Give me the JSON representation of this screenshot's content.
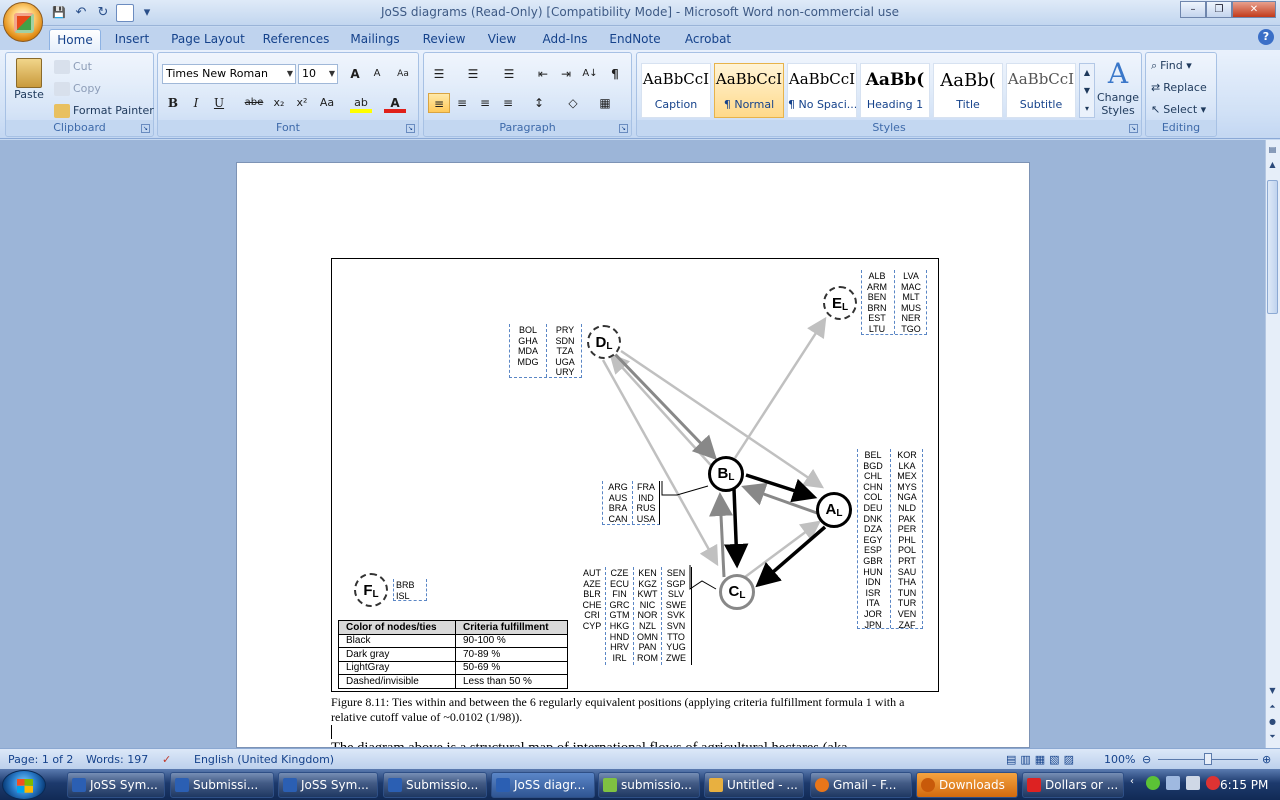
{
  "window": {
    "title": "JoSS diagrams (Read-Only) [Compatibility Mode] - Microsoft Word non-commercial use",
    "minimize": "–",
    "restore": "❐",
    "close": "✕"
  },
  "qat": {
    "save": "💾",
    "undo": "↶",
    "redo": "↻",
    "customize": "▾"
  },
  "tabs": [
    "Home",
    "Insert",
    "Page Layout",
    "References",
    "Mailings",
    "Review",
    "View",
    "Add-Ins",
    "EndNote",
    "Acrobat"
  ],
  "clipboard": {
    "group": "Clipboard",
    "paste": "Paste",
    "cut": "Cut",
    "copy": "Copy",
    "format_painter": "Format Painter"
  },
  "font": {
    "group": "Font",
    "name": "Times New Roman",
    "size": "10",
    "grow": "A",
    "shrink": "A",
    "clear": "Aa",
    "bold": "B",
    "italic": "I",
    "underline": "U",
    "strike": "abe",
    "subscript": "x₂",
    "superscript": "x²",
    "case": "Aa",
    "highlight": "ab",
    "color": "A"
  },
  "paragraph": {
    "group": "Paragraph",
    "bullets": "☰",
    "numbering": "☰",
    "multilevel": "☰",
    "dec_indent": "⇤",
    "inc_indent": "⇥",
    "sort": "A↓",
    "pilcrow": "¶",
    "align_left": "≡",
    "center": "≡",
    "align_right": "≡",
    "justify": "≡",
    "spacing": "↕",
    "shading": "◇",
    "borders": "▦"
  },
  "styles": {
    "group": "Styles",
    "preview": "AaBbCcI",
    "heading_preview": "AaBb(",
    "items": [
      "Caption",
      "¶ Normal",
      "¶ No Spaci...",
      "Heading 1",
      "Title",
      "Subtitle"
    ],
    "change_styles": "Change Styles"
  },
  "editing": {
    "group": "Editing",
    "find": "Find",
    "replace": "Replace",
    "select": "Select"
  },
  "figure": {
    "nodes": {
      "A": "A",
      "B": "B",
      "C": "C",
      "D": "D",
      "E": "E",
      "F": "F",
      "sub": "L"
    },
    "E_list": {
      "c1": [
        "ALB",
        "ARM",
        "BEN",
        "BRN",
        "EST",
        "LTU"
      ],
      "c2": [
        "LVA",
        "MAC",
        "MLT",
        "MUS",
        "NER",
        "TGO"
      ]
    },
    "D_list": {
      "c1": [
        "BOL",
        "GHA",
        "MDA",
        "MDG"
      ],
      "c2": [
        "PRY",
        "SDN",
        "TZA",
        "UGA",
        "URY"
      ]
    },
    "A_list": {
      "c1": [
        "BEL",
        "BGD",
        "CHL",
        "CHN",
        "COL",
        "DEU",
        "DNK",
        "DZA",
        "EGY",
        "ESP",
        "GBR",
        "HUN",
        "IDN",
        "ISR",
        "ITA",
        "JOR",
        "JPN"
      ],
      "c2": [
        "KOR",
        "LKA",
        "MEX",
        "MYS",
        "NGA",
        "NLD",
        "PAK",
        "PER",
        "PHL",
        "POL",
        "PRT",
        "SAU",
        "THA",
        "TUN",
        "TUR",
        "VEN",
        "ZAF"
      ]
    },
    "B_list": {
      "c1": [
        "ARG",
        "AUS",
        "BRA",
        "CAN"
      ],
      "c2": [
        "FRA",
        "IND",
        "RUS",
        "USA"
      ]
    },
    "C_list": {
      "c1": [
        "AUT",
        "AZE",
        "BLR",
        "CHE",
        "CRI",
        "CYP"
      ],
      "c2": [
        "CZE",
        "ECU",
        "FIN",
        "GRC",
        "GTM",
        "HKG",
        "HND",
        "HRV",
        "IRL"
      ],
      "c3": [
        "KEN",
        "KGZ",
        "KWT",
        "NIC",
        "NOR",
        "NZL",
        "OMN",
        "PAN",
        "ROM"
      ],
      "c4": [
        "SEN",
        "SGP",
        "SLV",
        "SWE",
        "SVK",
        "SVN",
        "TTO",
        "YUG",
        "ZWE"
      ]
    },
    "F_list": {
      "c1": [
        "BRB",
        "ISL"
      ]
    },
    "legend": {
      "headers": [
        "Color of nodes/ties",
        "Criteria fulfillment"
      ],
      "rows": [
        [
          "Black",
          "90-100 %"
        ],
        [
          "Dark gray",
          "70-89 %"
        ],
        [
          "LightGray",
          "50-69 %"
        ],
        [
          "Dashed/invisible",
          "Less than 50 %"
        ]
      ]
    },
    "caption": "Figure 8.11: Ties within and between the 6 regularly equivalent positions (applying criteria fulfillment formula 1 with a relative cutoff value of ~0.0102 (1/98)).",
    "body_text": "The diagram above is a structural map of international flows of agricultural hectares (aka",
    "colors": {
      "black": "#000000",
      "dark_gray": "#888888",
      "light_gray": "#c0c0c0"
    }
  },
  "status": {
    "page": "Page: 1 of 2",
    "words": "Words: 197",
    "language": "English (United Kingdom)",
    "zoom": "100%"
  },
  "taskbar": {
    "items": [
      "JoSS Sym...",
      "Submissi...",
      "JoSS Sym...",
      "Submissio...",
      "JoSS diagr...",
      "submissio...",
      "Untitled - ...",
      "Gmail - F...",
      "Downloads",
      "Dollars or ..."
    ],
    "clock": "6:15 PM"
  }
}
